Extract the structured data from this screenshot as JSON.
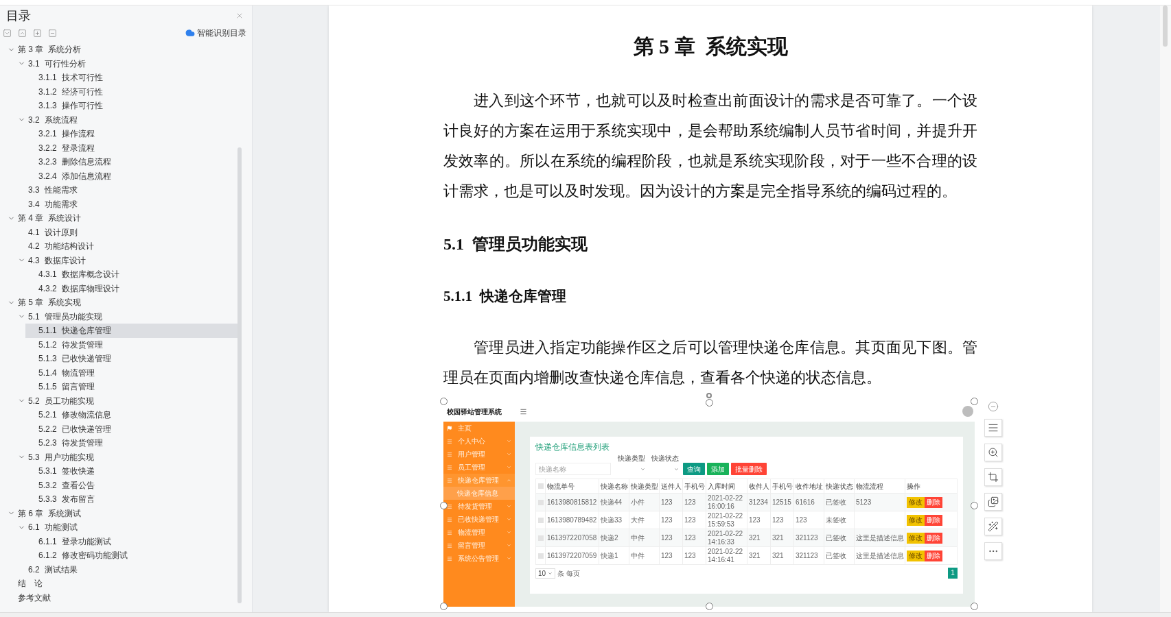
{
  "nav_pane": {
    "title": "目录",
    "smart_toc": "智能识别目录",
    "tree": [
      {
        "number": "第 3 章",
        "title": "系统分析",
        "expanded": true,
        "selected": false,
        "children": [
          {
            "number": "3.1",
            "title": "可行性分析",
            "expanded": true,
            "selected": false,
            "children": [
              {
                "number": "3.1.1",
                "title": "技术可行性",
                "selected": false
              },
              {
                "number": "3.1.2",
                "title": "经济可行性",
                "selected": false
              },
              {
                "number": "3.1.3",
                "title": "操作可行性",
                "selected": false
              }
            ]
          },
          {
            "number": "3.2",
            "title": "系统流程",
            "expanded": true,
            "selected": false,
            "children": [
              {
                "number": "3.2.1",
                "title": "操作流程",
                "selected": false
              },
              {
                "number": "3.2.2",
                "title": "登录流程",
                "selected": false
              },
              {
                "number": "3.2.3",
                "title": "删除信息流程",
                "selected": false
              },
              {
                "number": "3.2.4",
                "title": "添加信息流程",
                "selected": false
              }
            ]
          },
          {
            "number": "3.3",
            "title": "性能需求",
            "selected": false
          },
          {
            "number": "3.4",
            "title": "功能需求",
            "selected": false
          }
        ]
      },
      {
        "number": "第 4 章",
        "title": "系统设计",
        "expanded": true,
        "selected": false,
        "children": [
          {
            "number": "4.1",
            "title": "设计原则",
            "selected": false
          },
          {
            "number": "4.2",
            "title": "功能结构设计",
            "selected": false
          },
          {
            "number": "4.3",
            "title": "数据库设计",
            "expanded": true,
            "selected": false,
            "children": [
              {
                "number": "4.3.1",
                "title": "数据库概念设计",
                "selected": false
              },
              {
                "number": "4.3.2",
                "title": "数据库物理设计",
                "selected": false
              }
            ]
          }
        ]
      },
      {
        "number": "第 5 章",
        "title": "系统实现",
        "expanded": true,
        "selected": false,
        "children": [
          {
            "number": "5.1",
            "title": "管理员功能实现",
            "expanded": true,
            "selected": false,
            "children": [
              {
                "number": "5.1.1",
                "title": "快递仓库管理",
                "selected": true
              },
              {
                "number": "5.1.2",
                "title": "待发货管理",
                "selected": false
              },
              {
                "number": "5.1.3",
                "title": "已收快递管理",
                "selected": false
              },
              {
                "number": "5.1.4",
                "title": "物流管理",
                "selected": false
              },
              {
                "number": "5.1.5",
                "title": "留言管理",
                "selected": false
              }
            ]
          },
          {
            "number": "5.2",
            "title": "员工功能实现",
            "expanded": true,
            "selected": false,
            "children": [
              {
                "number": "5.2.1",
                "title": "修改物流信息",
                "selected": false
              },
              {
                "number": "5.2.2",
                "title": "已收快递管理",
                "selected": false
              },
              {
                "number": "5.2.3",
                "title": "待发货管理",
                "selected": false
              }
            ]
          },
          {
            "number": "5.3",
            "title": "用户功能实现",
            "expanded": true,
            "selected": false,
            "children": [
              {
                "number": "5.3.1",
                "title": "签收快递",
                "selected": false
              },
              {
                "number": "5.3.2",
                "title": "查看公告",
                "selected": false
              },
              {
                "number": "5.3.3",
                "title": "发布留言",
                "selected": false
              }
            ]
          }
        ]
      },
      {
        "number": "第 6 章",
        "title": "系统测试",
        "expanded": true,
        "selected": false,
        "children": [
          {
            "number": "6.1",
            "title": "功能测试",
            "expanded": true,
            "selected": false,
            "children": [
              {
                "number": "6.1.1",
                "title": "登录功能测试",
                "selected": false
              },
              {
                "number": "6.1.2",
                "title": "修改密码功能测试",
                "selected": false
              }
            ]
          },
          {
            "number": "6.2",
            "title": "测试结果",
            "selected": false
          }
        ]
      },
      {
        "title": "结　论",
        "selected": false
      },
      {
        "title": "参考文献",
        "selected": false
      }
    ]
  },
  "document": {
    "blocks": [
      {
        "kind": "chapter_title",
        "text": "第 5 章  系统实现"
      },
      {
        "kind": "paragraph",
        "text": "进入到这个环节，也就可以及时检查出前面设计的需求是否可靠了。一个设计良好的方案在运用于系统实现中，是会帮助系统编制人员节省时间，并提升开发效率的。所以在系统的编程阶段，也就是系统实现阶段，对于一些不合理的设计需求，也是可以及时发现。因为设计的方案是完全指导系统的编码过程的。"
      },
      {
        "kind": "heading",
        "text": "5.1  管理员功能实现"
      },
      {
        "kind": "subheading",
        "text": "5.1.1  快递仓库管理"
      },
      {
        "kind": "paragraph",
        "text": "管理员进入指定功能操作区之后可以管理快递仓库信息。其页面见下图。管理员在页面内增删改查快递仓库信息，查看各个快递的状态信息。"
      }
    ],
    "figure": {
      "selected": true,
      "app": {
        "title": "校园驿站管理系统",
        "menu": [
          {
            "label": "主页",
            "kind": "home",
            "selected": false
          },
          {
            "label": "个人中心",
            "kind": "group",
            "expanded": false,
            "selected": false
          },
          {
            "label": "用户管理",
            "kind": "group",
            "expanded": false,
            "selected": false
          },
          {
            "label": "员工管理",
            "kind": "group",
            "expanded": false,
            "selected": false
          },
          {
            "label": "快递仓库管理",
            "kind": "group",
            "expanded": true,
            "selected": false
          },
          {
            "label": "快递仓库信息",
            "kind": "subitem",
            "selected": true
          },
          {
            "label": "待发货管理",
            "kind": "group",
            "expanded": false,
            "selected": false
          },
          {
            "label": "已收快递管理",
            "kind": "group",
            "expanded": false,
            "selected": false
          },
          {
            "label": "物流管理",
            "kind": "group",
            "expanded": false,
            "selected": false
          },
          {
            "label": "留言管理",
            "kind": "group",
            "expanded": false,
            "selected": false
          },
          {
            "label": "系统公告管理",
            "kind": "group",
            "expanded": false,
            "selected": false
          }
        ],
        "panel": {
          "title": "快递仓库信息表列表",
          "search_placeholder": "快递名称",
          "filters": [
            "快递类型",
            "快递状态"
          ],
          "buttons": [
            {
              "label": "查询",
              "kind": "search"
            },
            {
              "label": "添加",
              "kind": "add"
            },
            {
              "label": "批量删除",
              "kind": "delete"
            }
          ],
          "header_checked": false,
          "columns": [
            "物流单号",
            "快递名称",
            "快递类型",
            "送件人",
            "手机号",
            "入库时间",
            "收件人",
            "手机号",
            "收件地址",
            "快递状态",
            "物流流程",
            "操作"
          ],
          "rows": [
            {
              "checked": false,
              "cells": [
                "1613980815812",
                "快递44",
                "小件",
                "123",
                "123",
                "2021-02-22 16:00:16",
                "31234",
                "12515",
                "61616",
                "已签收",
                "5123"
              ],
              "actions": [
                {
                  "label": "修改",
                  "kind": "edit"
                },
                {
                  "label": "删除",
                  "kind": "delete"
                }
              ]
            },
            {
              "checked": false,
              "cells": [
                "1613980789482",
                "快递33",
                "大件",
                "123",
                "123",
                "2021-02-22 15:59:53",
                "123",
                "123",
                "123",
                "未签收",
                ""
              ],
              "actions": [
                {
                  "label": "修改",
                  "kind": "edit"
                },
                {
                  "label": "删除",
                  "kind": "delete"
                }
              ]
            },
            {
              "checked": false,
              "cells": [
                "1613972207058",
                "快递2",
                "中件",
                "123",
                "123",
                "2021-02-22 14:16:33",
                "321",
                "321",
                "321123",
                "已签收",
                "这里是描述信息"
              ],
              "actions": [
                {
                  "label": "修改",
                  "kind": "edit"
                },
                {
                  "label": "删除",
                  "kind": "delete"
                }
              ]
            },
            {
              "checked": false,
              "cells": [
                "1613972207059",
                "快递1",
                "中件",
                "123",
                "123",
                "2021-02-22 14:16:41",
                "321",
                "321",
                "321123",
                "已签收",
                "这里是描述信息"
              ],
              "actions": [
                {
                  "label": "修改",
                  "kind": "edit"
                },
                {
                  "label": "删除",
                  "kind": "delete"
                }
              ]
            }
          ],
          "page_size": "10",
          "page_size_label": "条 每页",
          "current_page": "1"
        }
      }
    }
  }
}
